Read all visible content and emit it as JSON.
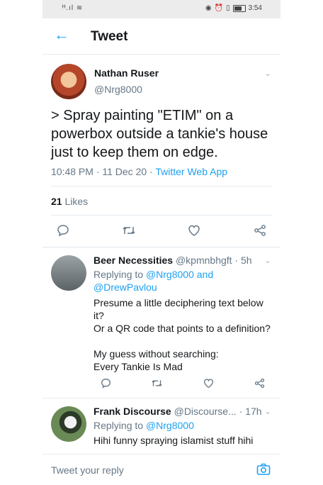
{
  "status_bar": {
    "left": "ᴴ.ıl ≋",
    "time": "3:54"
  },
  "header": {
    "title": "Tweet"
  },
  "tweet": {
    "name": "Nathan Ruser",
    "handle": "@Nrg8000",
    "text": "> Spray painting \"ETIM\" on a powerbox outside a tankie's house just to keep them on edge.",
    "time": "10:48 PM · 11 Dec 20 · ",
    "client": "Twitter Web App",
    "likes_count": "21",
    "likes_label": " Likes"
  },
  "replies": [
    {
      "name": "Beer Necessities",
      "handle_time": " @kpmnbhgft · 5h",
      "replying_prefix": "Replying to ",
      "replying_users": "@Nrg8000 and",
      "replying_users2": "@DrewPavlou",
      "line1": "Presume a little deciphering text below it?",
      "line2": "Or a QR code that points to a definition?",
      "line3": "My guess without searching:",
      "line4": "Every Tankie Is Mad"
    },
    {
      "name": "Frank Discourse",
      "handle_time": " @Discourse... · 17h",
      "replying_prefix": "Replying to ",
      "replying_users": "@Nrg8000",
      "line1": "Hihi funny spraying islamist stuff hihi"
    }
  ],
  "footer": {
    "placeholder": "Tweet your reply"
  },
  "colors": {
    "accent": "#1da1f2",
    "muted": "#657786"
  }
}
